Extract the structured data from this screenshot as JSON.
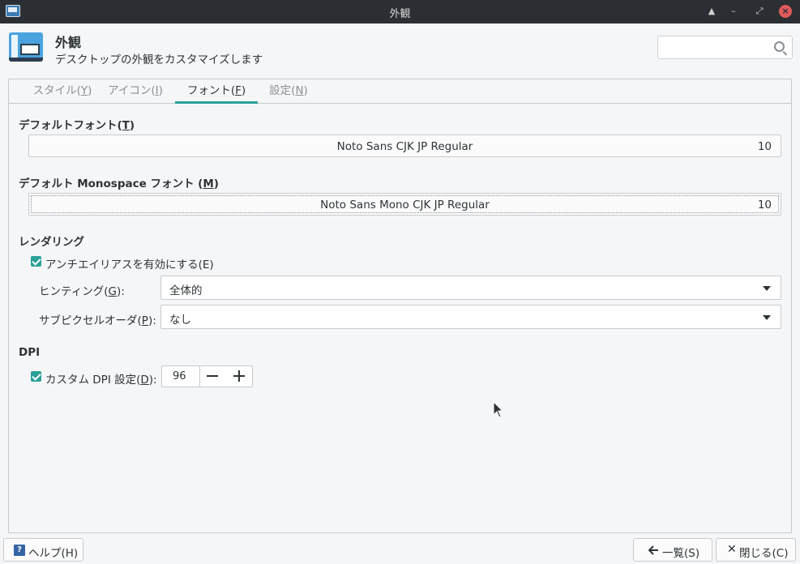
{
  "window": {
    "title": "外観"
  },
  "header": {
    "title": "外観",
    "subtitle": "デスクトップの外観をカスタマイズします",
    "search_placeholder": ""
  },
  "tabs": [
    {
      "label": "スタイル(",
      "key": "Y",
      "tail": ")",
      "active": false
    },
    {
      "label": "アイコン(",
      "key": "I",
      "tail": ")",
      "active": false
    },
    {
      "label": "フォント(",
      "key": "F",
      "tail": ")",
      "active": true
    },
    {
      "label": "設定(",
      "key": "N",
      "tail": ")",
      "active": false
    }
  ],
  "default_font": {
    "section_label": "デフォルトフォント(",
    "section_key": "T",
    "section_tail": ")",
    "name": "Noto Sans CJK JP Regular",
    "size": "10"
  },
  "mono_font": {
    "section_label": "デフォルト Monospace フォント (",
    "section_key": "M",
    "section_tail": ")",
    "name": "Noto Sans Mono CJK JP Regular",
    "size": "10"
  },
  "rendering": {
    "section_label": "レンダリング",
    "antialias_label": "アンチエイリアスを有効にする(E)",
    "antialias_checked": true,
    "hinting_label": "ヒンティング(",
    "hinting_key": "G",
    "hinting_tail": "):",
    "hinting_value": "全体的",
    "subpixel_label": "サブピクセルオーダ(",
    "subpixel_key": "P",
    "subpixel_tail": "):",
    "subpixel_value": "なし"
  },
  "dpi": {
    "section_label": "DPI",
    "custom_label": "カスタム DPI 設定(",
    "custom_key": "D",
    "custom_tail": "):",
    "custom_checked": true,
    "value": "96"
  },
  "footer": {
    "help_label": "ヘルプ(H)",
    "back_label": "一覧(S)",
    "close_label": "閉じる(C)"
  }
}
